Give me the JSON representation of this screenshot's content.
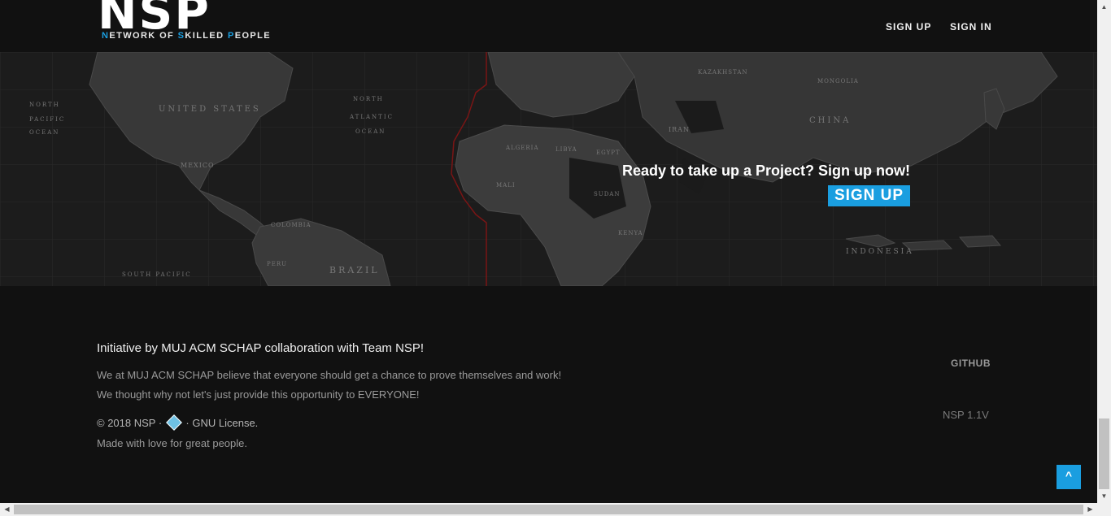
{
  "header": {
    "logo_mark": "NSP",
    "logo_tagline_parts": [
      {
        "text": "N",
        "hl": true
      },
      {
        "text": "ETWORK OF ",
        "hl": false
      },
      {
        "text": "S",
        "hl": true
      },
      {
        "text": "KILLED ",
        "hl": false
      },
      {
        "text": "P",
        "hl": true
      },
      {
        "text": "EOPLE",
        "hl": false
      }
    ],
    "nav": {
      "signup": "SIGN UP",
      "signin": "SIGN IN"
    }
  },
  "banner": {
    "cta_text": "Ready to take up a Project? Sign up now!",
    "cta_button": "SIGN UP",
    "map_labels": [
      "UNITED STATES",
      "MEXICO",
      "COLOMBIA",
      "BRAZIL",
      "PERU",
      "ALGERIA",
      "LIBYA",
      "EGYPT",
      "MALI",
      "SUDAN",
      "KENYA",
      "IRAN",
      "CHINA",
      "MONGOLIA",
      "KAZAKHSTAN",
      "INDONESIA",
      "NORTH PACIFIC OCEAN",
      "NORTH ATLANTIC OCEAN",
      "SOUTH PACIFIC"
    ]
  },
  "footer": {
    "title": "Initiative by MUJ ACM SCHAP collaboration with Team NSP!",
    "line1": "We at MUJ ACM SCHAP believe that everyone should get a chance to prove themselves and work!",
    "line2": "We thought why not let's just provide this opportunity to EVERYONE!",
    "copyright_pre": "© 2018 NSP ·",
    "copyright_post": "· GNU License.",
    "made_with": "Made with love for great people.",
    "github": "GITHUB",
    "version": "NSP 1.1V",
    "back_to_top": "^"
  },
  "colors": {
    "accent": "#1a9ee0",
    "background": "#111111",
    "map_land": "#3a3a3a"
  }
}
